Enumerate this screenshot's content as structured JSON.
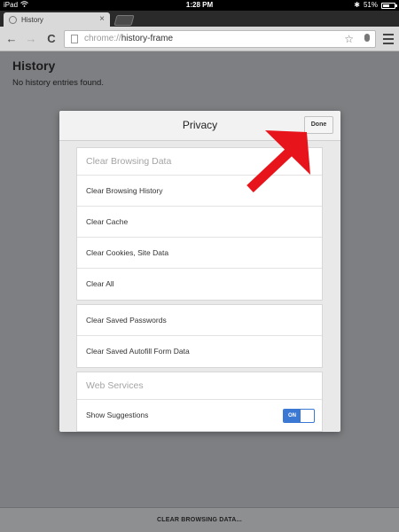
{
  "status_bar": {
    "device": "iPad",
    "time": "1:28 PM",
    "battery": "51%",
    "battery_level": 0.51
  },
  "tabs": [
    {
      "title": "History",
      "close": "×",
      "icon": "globe-icon"
    }
  ],
  "toolbar": {
    "back": "←",
    "forward": "→",
    "reload": "C",
    "url_scheme": "chrome://",
    "url_path": "history-frame",
    "bookmark": "☆"
  },
  "page": {
    "title": "History",
    "empty_message": "No history entries found."
  },
  "privacy_dialog": {
    "title": "Privacy",
    "done_label": "Done",
    "clear_browsing": {
      "header": "Clear Browsing Data",
      "items": [
        "Clear Browsing History",
        "Clear Cache",
        "Clear Cookies, Site Data",
        "Clear All"
      ]
    },
    "saved_data": {
      "items": [
        "Clear Saved Passwords",
        "Clear Saved Autofill Form Data"
      ]
    },
    "web_services": {
      "header": "Web Services",
      "show_suggestions_label": "Show Suggestions",
      "toggle_state": "ON"
    }
  },
  "bottom_bar": {
    "label": "CLEAR BROWSING DATA..."
  },
  "colors": {
    "accent_blue": "#3a78d3",
    "annotation_red": "#e8141b",
    "backdrop_gray": "#7d7f82"
  }
}
